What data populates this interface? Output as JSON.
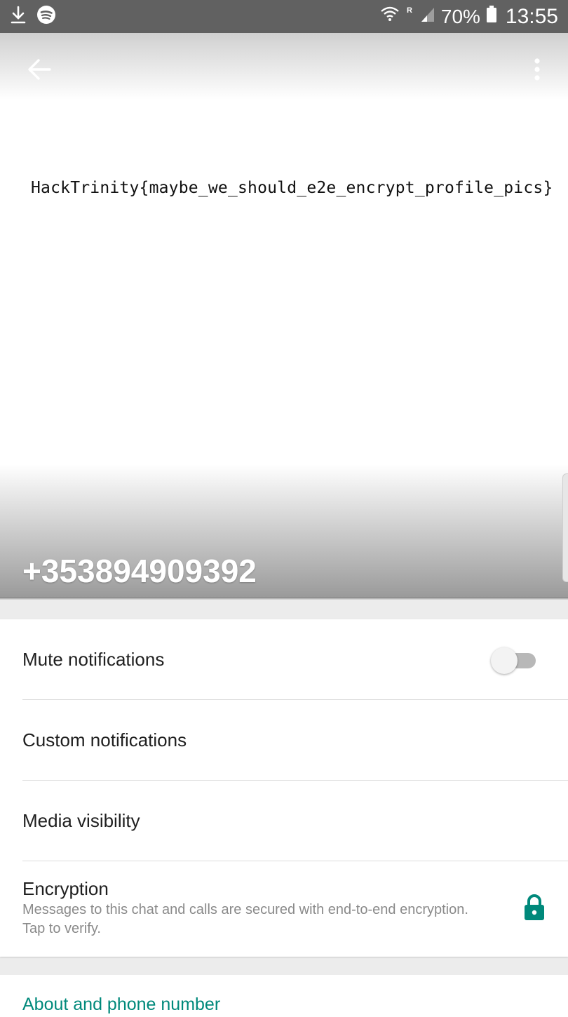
{
  "status_bar": {
    "battery_percent": "70%",
    "time": "13:55",
    "left_icons": [
      "download-icon",
      "spotify-icon"
    ],
    "right_icons": [
      "wifi-icon",
      "roaming-icon",
      "signal-icon",
      "battery-icon"
    ]
  },
  "header": {
    "profile_picture_text": "HackTrinity{maybe_we_should_e2e_encrypt_profile_pics}",
    "contact_name": "+353894909392",
    "back_icon": "back-arrow-icon",
    "menu_icon": "more-vert-icon"
  },
  "settings": {
    "mute_label": "Mute notifications",
    "mute_enabled": false,
    "custom_label": "Custom notifications",
    "media_label": "Media visibility",
    "encryption_label": "Encryption",
    "encryption_subtitle": "Messages to this chat and calls are secured with end-to-end encryption. Tap to verify."
  },
  "about": {
    "label": "About and phone number"
  },
  "colors": {
    "accent": "#00897b",
    "status_bar": "#616161"
  }
}
